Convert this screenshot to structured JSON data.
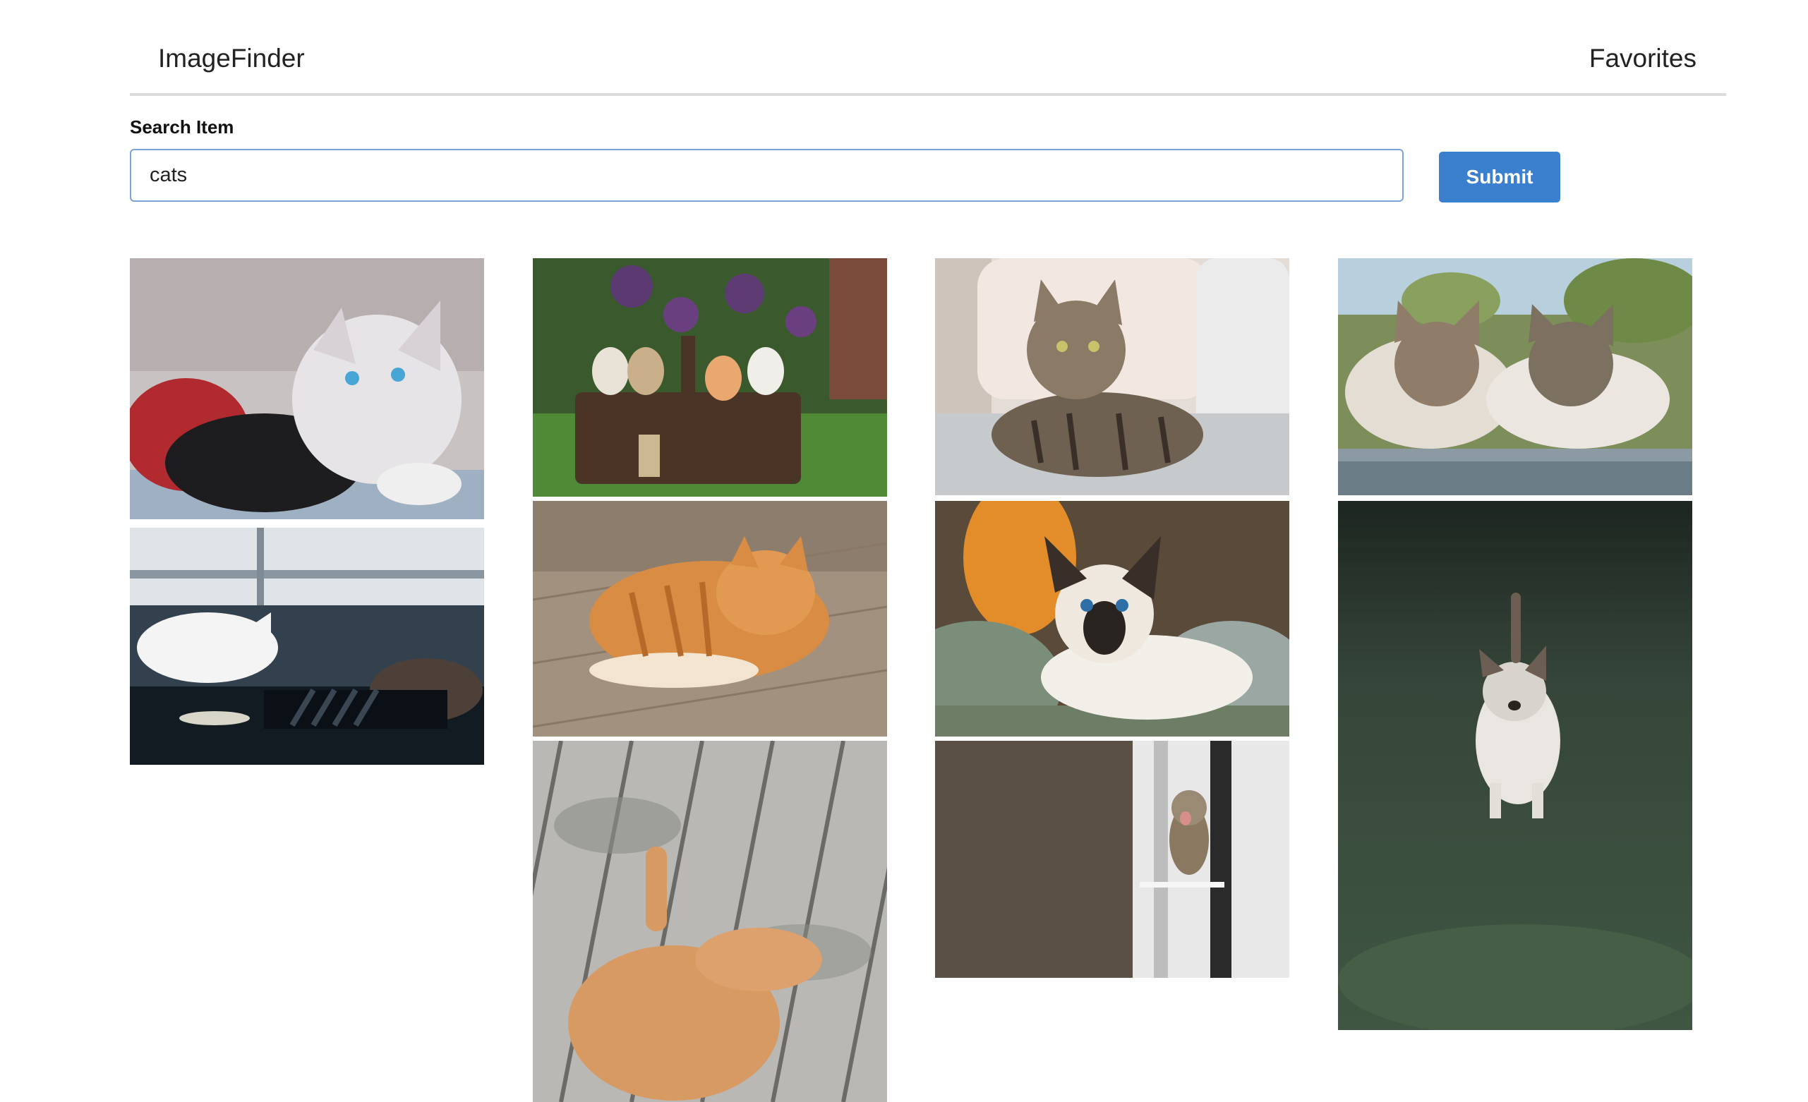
{
  "app": {
    "brand": "ImageFinder",
    "favorites_link": "Favorites"
  },
  "search": {
    "label": "Search Item",
    "value": "cats",
    "placeholder": ""
  },
  "actions": {
    "submit_label": "Submit"
  },
  "colors": {
    "accent": "#3b7fcf",
    "input_border": "#7aa3d8",
    "divider": "#dcdcdc"
  },
  "results": [
    {
      "column": 1,
      "subject": "kittens-cuddling-on-blanket"
    },
    {
      "column": 1,
      "subject": "cats-sleeping-on-windowsill"
    },
    {
      "column": 2,
      "subject": "kittens-in-wicker-basket"
    },
    {
      "column": 2,
      "subject": "orange-cat-on-wood-floor"
    },
    {
      "column": 2,
      "subject": "ginger-cat-on-wooden-deck"
    },
    {
      "column": 3,
      "subject": "tabby-cat-on-couch"
    },
    {
      "column": 3,
      "subject": "siamese-kitten-on-blanket"
    },
    {
      "column": 3,
      "subject": "kitten-yawning-at-window"
    },
    {
      "column": 4,
      "subject": "two-tabby-cats-outdoors"
    },
    {
      "column": 4,
      "subject": "kitten-walking-in-grass"
    }
  ]
}
